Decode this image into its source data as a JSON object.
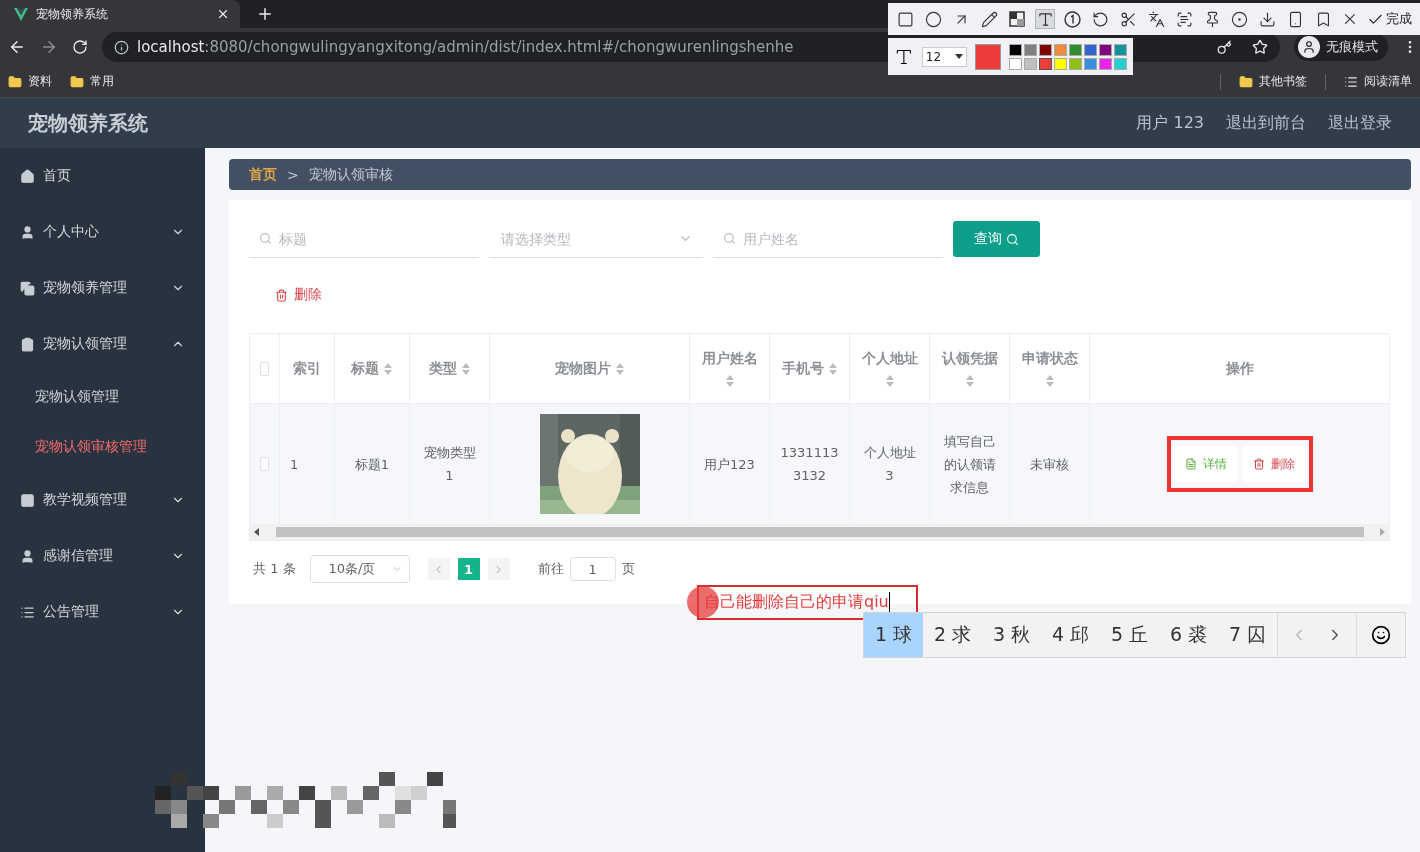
{
  "browser": {
    "tab_title": "宠物领养系统",
    "url_host": "localhost",
    "url_path": ":8080/chongwulingyangxitong/admin/dist/index.html#/chongwurenlingshenhe",
    "incognito_label": "无痕模式",
    "bookmarks": [
      "资料",
      "常用"
    ],
    "other_bookmarks": "其他书签",
    "reading_list": "阅读清单"
  },
  "annotation_toolbar": {
    "done_label": "完成",
    "font_size": "12",
    "palette": [
      {
        "color": "#000000",
        "selected": false
      },
      {
        "color": "#808080",
        "selected": false
      },
      {
        "color": "#800000",
        "selected": false
      },
      {
        "color": "#f08a3c",
        "selected": false
      },
      {
        "color": "#2e8b2e",
        "selected": false
      },
      {
        "color": "#3366cc",
        "selected": false
      },
      {
        "color": "#800080",
        "selected": false
      },
      {
        "color": "#12949a",
        "selected": false
      },
      {
        "color": "#ffffff",
        "selected": false
      },
      {
        "color": "#c0c0c0",
        "selected": false
      },
      {
        "color": "#ee3b3b",
        "selected": true
      },
      {
        "color": "#ffff00",
        "selected": false
      },
      {
        "color": "#92c01a",
        "selected": false
      },
      {
        "color": "#3a8fe0",
        "selected": false
      },
      {
        "color": "#ee22ee",
        "selected": false
      },
      {
        "color": "#22d0d0",
        "selected": false
      }
    ]
  },
  "header": {
    "title": "宠物领养系统",
    "user": "用户 123",
    "links": [
      "退出到前台",
      "退出登录"
    ]
  },
  "sidebar": {
    "items": [
      {
        "label": "首页",
        "kind": "link"
      },
      {
        "label": "个人中心",
        "kind": "menu",
        "expanded": false
      },
      {
        "label": "宠物领养管理",
        "kind": "menu",
        "expanded": false
      },
      {
        "label": "宠物认领管理",
        "kind": "menu",
        "expanded": true,
        "children": [
          {
            "label": "宠物认领管理",
            "selected": false
          },
          {
            "label": "宠物认领审核管理",
            "selected": true
          }
        ]
      },
      {
        "label": "教学视频管理",
        "kind": "menu",
        "expanded": false
      },
      {
        "label": "感谢信管理",
        "kind": "menu",
        "expanded": false
      },
      {
        "label": "公告管理",
        "kind": "menu",
        "expanded": false
      }
    ]
  },
  "breadcrumb": {
    "items": [
      "首页",
      "宠物认领审核"
    ],
    "separator": ">"
  },
  "filters": {
    "fields": [
      {
        "kind": "search",
        "placeholder": "标题"
      },
      {
        "kind": "select",
        "placeholder": "请选择类型"
      },
      {
        "kind": "search",
        "placeholder": "用户姓名"
      }
    ],
    "search_button": "查询"
  },
  "bulk_delete": "删除",
  "table": {
    "select_all": {
      "checked": false
    },
    "columns": [
      {
        "label": "索引",
        "sortable": false
      },
      {
        "label": "标题",
        "sortable": true
      },
      {
        "label": "类型",
        "sortable": true
      },
      {
        "label": "宠物图片",
        "sortable": true
      },
      {
        "label": "用户姓名",
        "sortable": true
      },
      {
        "label": "手机号",
        "sortable": true
      },
      {
        "label": "个人地址",
        "sortable": true
      },
      {
        "label": "认领凭据",
        "sortable": true
      },
      {
        "label": "申请状态",
        "sortable": true
      },
      {
        "label": "操作",
        "sortable": false
      }
    ],
    "rows": [
      {
        "checked": false,
        "cells": [
          "1",
          "标题1",
          "宠物类型1",
          {
            "kind": "picture"
          },
          "用户123",
          "13311133132",
          "个人地址3",
          "填写自己的认领请求信息",
          "未审核"
        ],
        "actions": [
          "详情",
          "删除"
        ]
      }
    ]
  },
  "pagination": {
    "total": "共 1 条",
    "page_size": "10条/页",
    "pages": [
      {
        "label": "1",
        "selected": true
      }
    ],
    "goto_label": "前往",
    "goto_value": "1",
    "goto_suffix": "页"
  },
  "annotation_text": "自己能删除自己的申请qiu",
  "ime": {
    "candidates": [
      {
        "label": "1 球",
        "selected": true
      },
      {
        "label": "2 求",
        "selected": false
      },
      {
        "label": "3 秋",
        "selected": false
      },
      {
        "label": "4 邱",
        "selected": false
      },
      {
        "label": "5 丘",
        "selected": false
      },
      {
        "label": "6 裘",
        "selected": false
      },
      {
        "label": "7 囚",
        "selected": false
      }
    ]
  }
}
